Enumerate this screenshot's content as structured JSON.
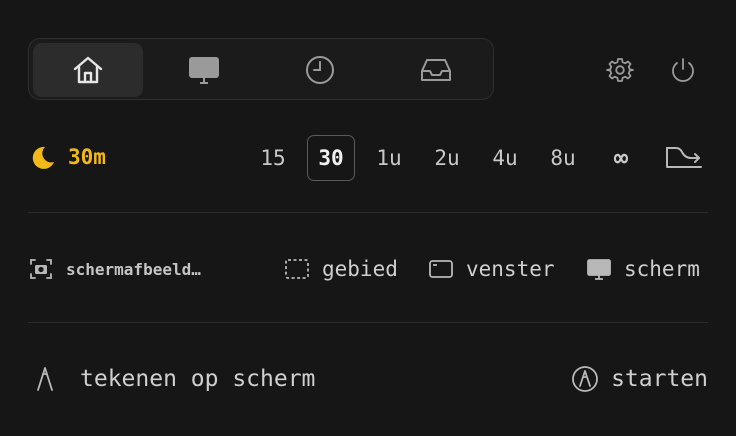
{
  "tabs": [
    {
      "icon": "home-icon",
      "active": true
    },
    {
      "icon": "monitor-icon",
      "active": false
    },
    {
      "icon": "clock-icon",
      "active": false
    },
    {
      "icon": "inbox-icon",
      "active": false
    }
  ],
  "top_actions": [
    {
      "icon": "gear-icon"
    },
    {
      "icon": "power-icon"
    }
  ],
  "timer": {
    "icon": "moon-icon",
    "value": "30m",
    "accent": "#f1b91a",
    "options": [
      "15",
      "30",
      "1u",
      "2u",
      "4u",
      "8u",
      "∞"
    ],
    "selected": "30",
    "trend_icon": "trend-down-icon"
  },
  "screenshot": {
    "label": "schermafbeeld…",
    "area_label": "gebied",
    "window_label": "venster",
    "screen_label": "scherm"
  },
  "draw": {
    "label": "tekenen op scherm",
    "start_label": "starten"
  }
}
